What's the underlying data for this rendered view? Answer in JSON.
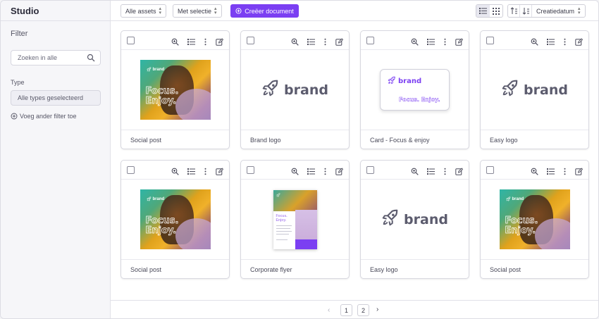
{
  "app": {
    "title": "Studio"
  },
  "sidebar": {
    "filter_title": "Filter",
    "search_placeholder": "Zoeken in alle",
    "type_label": "Type",
    "type_value": "Alle types geselecteerd",
    "add_filter": "Voeg ander filter toe"
  },
  "toolbar": {
    "assets_dropdown": "Alle assets",
    "selection_dropdown": "Met selectie",
    "create_button": "Creëer document",
    "sort_label": "Creatiedatum"
  },
  "brand_word": "brand",
  "photo_text": [
    "Focus.",
    "Enjoy."
  ],
  "card_text": "Focus. Enjoy.",
  "flyer_title": [
    "Focus.",
    "Enjoy."
  ],
  "cards": [
    {
      "caption": "Social post",
      "preview": "photo"
    },
    {
      "caption": "Brand logo",
      "preview": "logo"
    },
    {
      "caption": "Card - Focus & enjoy",
      "preview": "card"
    },
    {
      "caption": "Easy logo",
      "preview": "logo"
    },
    {
      "caption": "Social post",
      "preview": "photo"
    },
    {
      "caption": "Corporate flyer",
      "preview": "flyer"
    },
    {
      "caption": "Easy logo",
      "preview": "logo"
    },
    {
      "caption": "Social post",
      "preview": "photo"
    }
  ],
  "pagination": {
    "pages": [
      "1",
      "2"
    ]
  },
  "colors": {
    "accent": "#7b3ff2",
    "logo_gray": "#5c5c6e"
  }
}
